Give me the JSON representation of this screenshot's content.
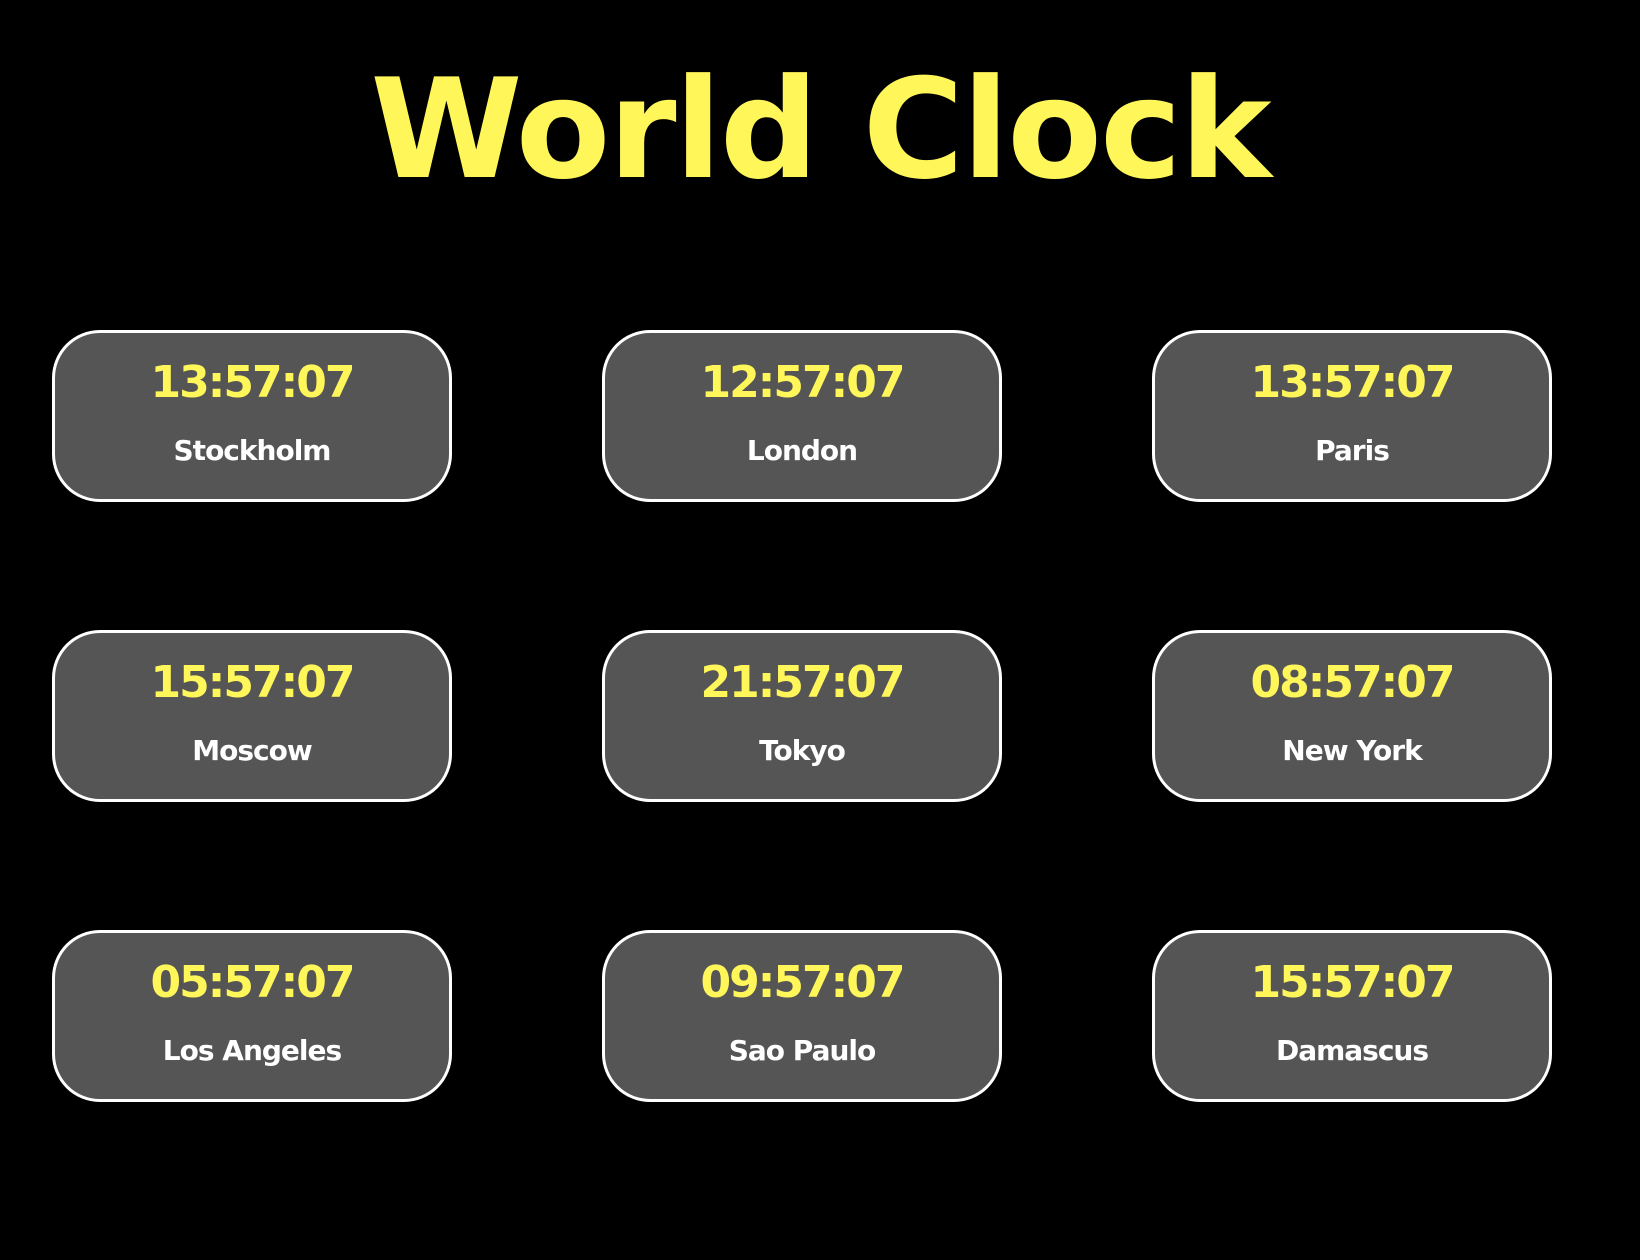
{
  "page": {
    "title": "World Clock"
  },
  "colors": {
    "background": "#000000",
    "accent": "#fff65a",
    "card_background": "#555555",
    "card_border": "#ffffff",
    "city_text": "#ffffff"
  },
  "clocks": [
    {
      "time": "13:57:07",
      "city": "Stockholm"
    },
    {
      "time": "12:57:07",
      "city": "London"
    },
    {
      "time": "13:57:07",
      "city": "Paris"
    },
    {
      "time": "15:57:07",
      "city": "Moscow"
    },
    {
      "time": "21:57:07",
      "city": "Tokyo"
    },
    {
      "time": "08:57:07",
      "city": "New York"
    },
    {
      "time": "05:57:07",
      "city": "Los Angeles"
    },
    {
      "time": "09:57:07",
      "city": "Sao Paulo"
    },
    {
      "time": "15:57:07",
      "city": "Damascus"
    }
  ]
}
